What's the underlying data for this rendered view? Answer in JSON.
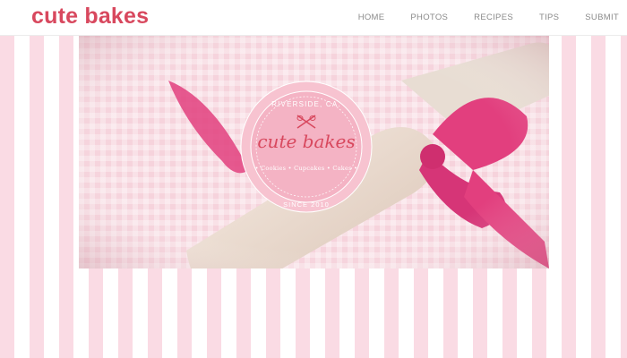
{
  "header": {
    "brand": "cute bakes",
    "nav": [
      "HOME",
      "PHOTOS",
      "RECIPES",
      "TIPS",
      "SUBMIT"
    ]
  },
  "hero": {
    "logo": {
      "location": "RIVERSIDE, CA.",
      "name": "cute bakes",
      "products": "• Cookies • Cupcakes • Cakes •",
      "since": "SINCE 2010"
    }
  },
  "colors": {
    "brand": "#d8485e",
    "stripe_pink": "#fadbe4",
    "ribbon": "#e23f7e"
  }
}
